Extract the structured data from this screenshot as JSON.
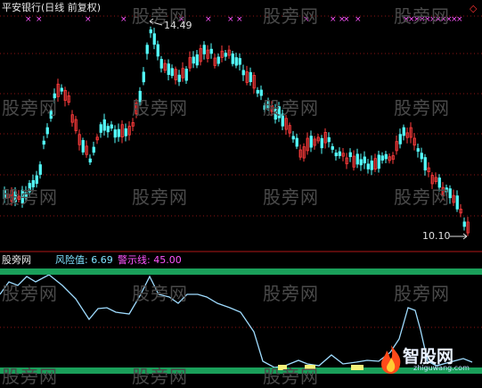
{
  "header": {
    "title": "平安银行(日线 前复权)"
  },
  "price_panel": {
    "high_label": "14.49",
    "low_label": "10.10"
  },
  "indicator_panel": {
    "name": "股旁网",
    "risk_label": "风险值: 6.69",
    "warning_label": "警示线: 45.00"
  },
  "watermark": {
    "text": "股旁网"
  },
  "logo": {
    "text": "智股网",
    "url": "zhiguwang.com"
  },
  "colors": {
    "background": "#000000",
    "up_candle": "#ff3b3b",
    "down_candle": "#54ffff",
    "indicator_line": "#9fdcff",
    "green_band": "#1a9f5a",
    "yellow_fill": "#f4f27a",
    "grid_dotted": "#8b1414",
    "marker": "#ff55ff"
  },
  "icons": {
    "diamond": "diamond-icon",
    "arrow": "arrow-icon",
    "flame": "flame-icon"
  }
}
